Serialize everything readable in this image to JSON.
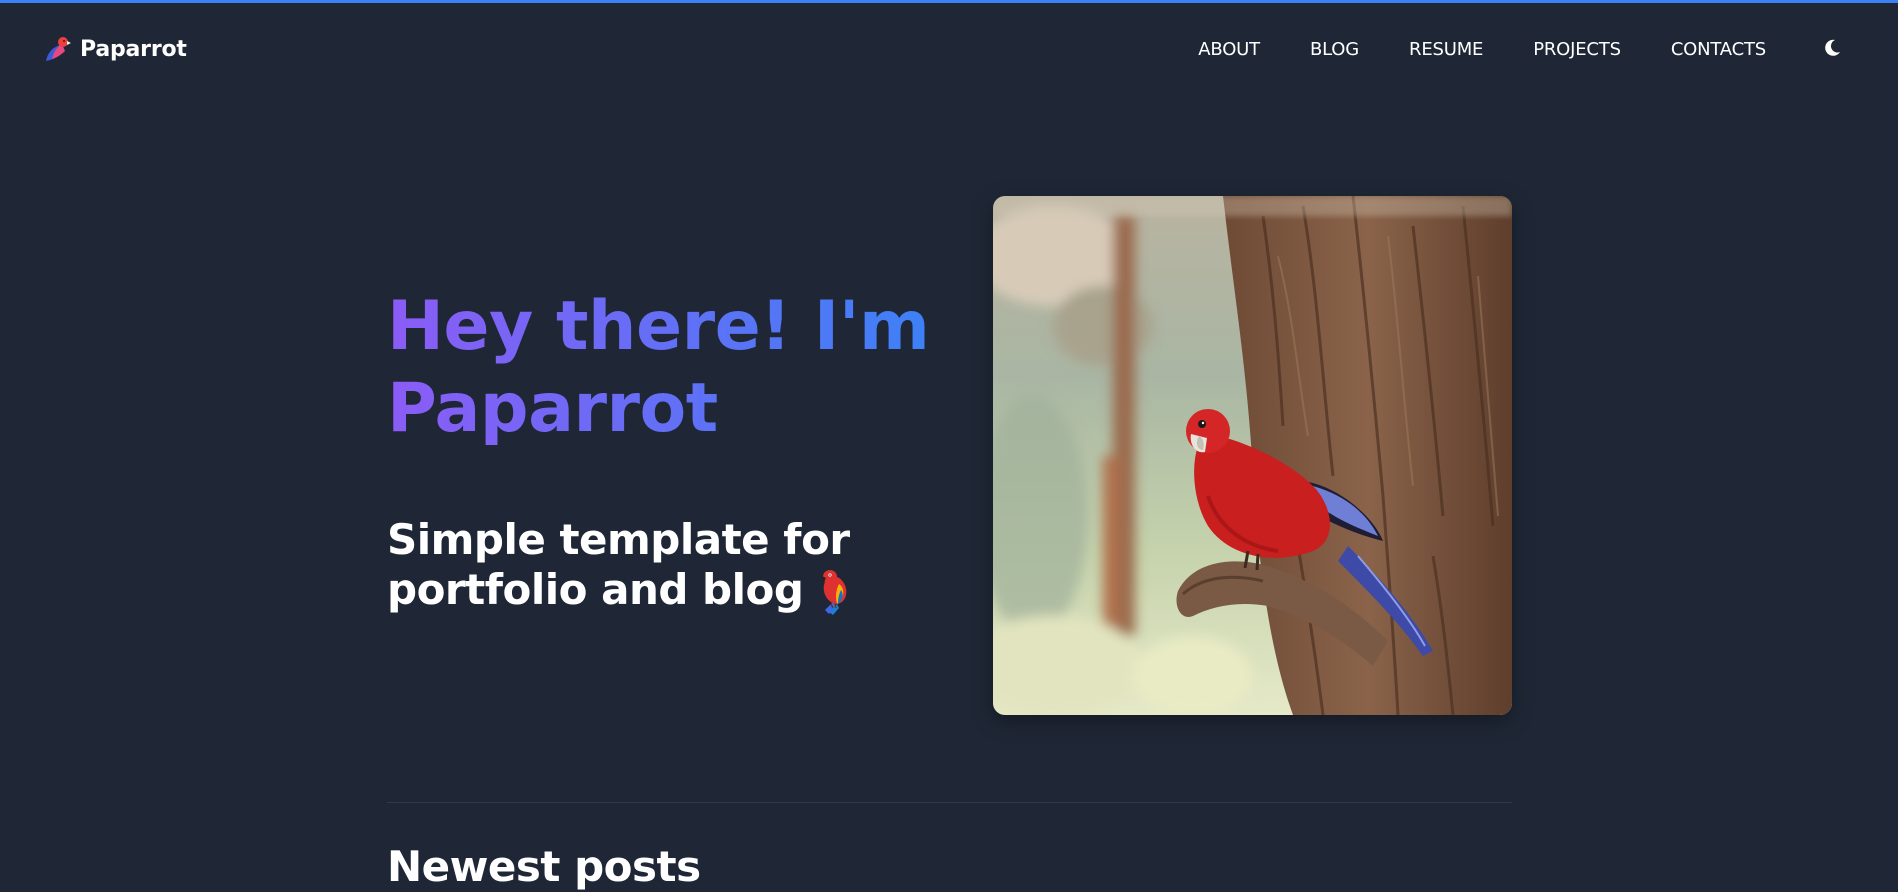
{
  "header": {
    "brand": "Paparrot",
    "nav": [
      {
        "label": "ABOUT"
      },
      {
        "label": "BLOG"
      },
      {
        "label": "RESUME"
      },
      {
        "label": "PROJECTS"
      },
      {
        "label": "CONTACTS"
      }
    ],
    "theme_toggle_icon": "moon-icon"
  },
  "hero": {
    "title_line1": "Hey there! I'm",
    "title_line2": "Paparrot",
    "subtitle_line1": "Simple template for",
    "subtitle_line2": "portfolio and blog",
    "emoji_icon": "parrot-emoji-icon",
    "image_alt": "red-parrot-on-branch-photo"
  },
  "posts": {
    "section_title": "Newest posts"
  },
  "colors": {
    "background": "#1f2736",
    "accent_top_border": "#3b82f6",
    "gradient_start": "#8b5cf6",
    "gradient_end": "#3b82f6",
    "text": "#ffffff"
  }
}
